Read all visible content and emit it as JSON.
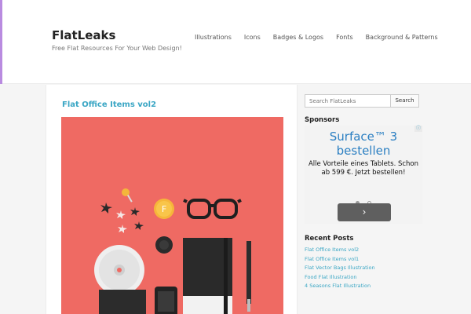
{
  "header": {
    "site_title": "FlatLeaks",
    "tagline": "Free Flat Resources For Your Web Design!",
    "nav": [
      "Illustrations",
      "Icons",
      "Badges & Logos",
      "Fonts",
      "Background & Patterns"
    ]
  },
  "post": {
    "title": "Flat Office Items vol2",
    "image_bg": "#ef6a63"
  },
  "sidebar": {
    "search": {
      "placeholder": "Search FlatLeaks",
      "button": "Search"
    },
    "sponsors_title": "Sponsors",
    "ad": {
      "headline": "Surface™ 3 bestellen",
      "body": "Alle Vorteile eines Tablets. Schon ab 599 €. Jetzt bestellen!",
      "next_icon": "chevron-right-icon",
      "corner_icon": "ad-choices-icon"
    },
    "recent_title": "Recent Posts",
    "recent_posts": [
      "Flat Office Items vol2",
      "Flat Office Items vol1",
      "Flat Vector Bags Illustration",
      "Food Flat Illustration",
      "4 Seasons Flat Illustration"
    ]
  },
  "colors": {
    "accent": "#3aa6c4",
    "purple_bar": "#b98be0",
    "ad_blue": "#2b7fc2"
  }
}
